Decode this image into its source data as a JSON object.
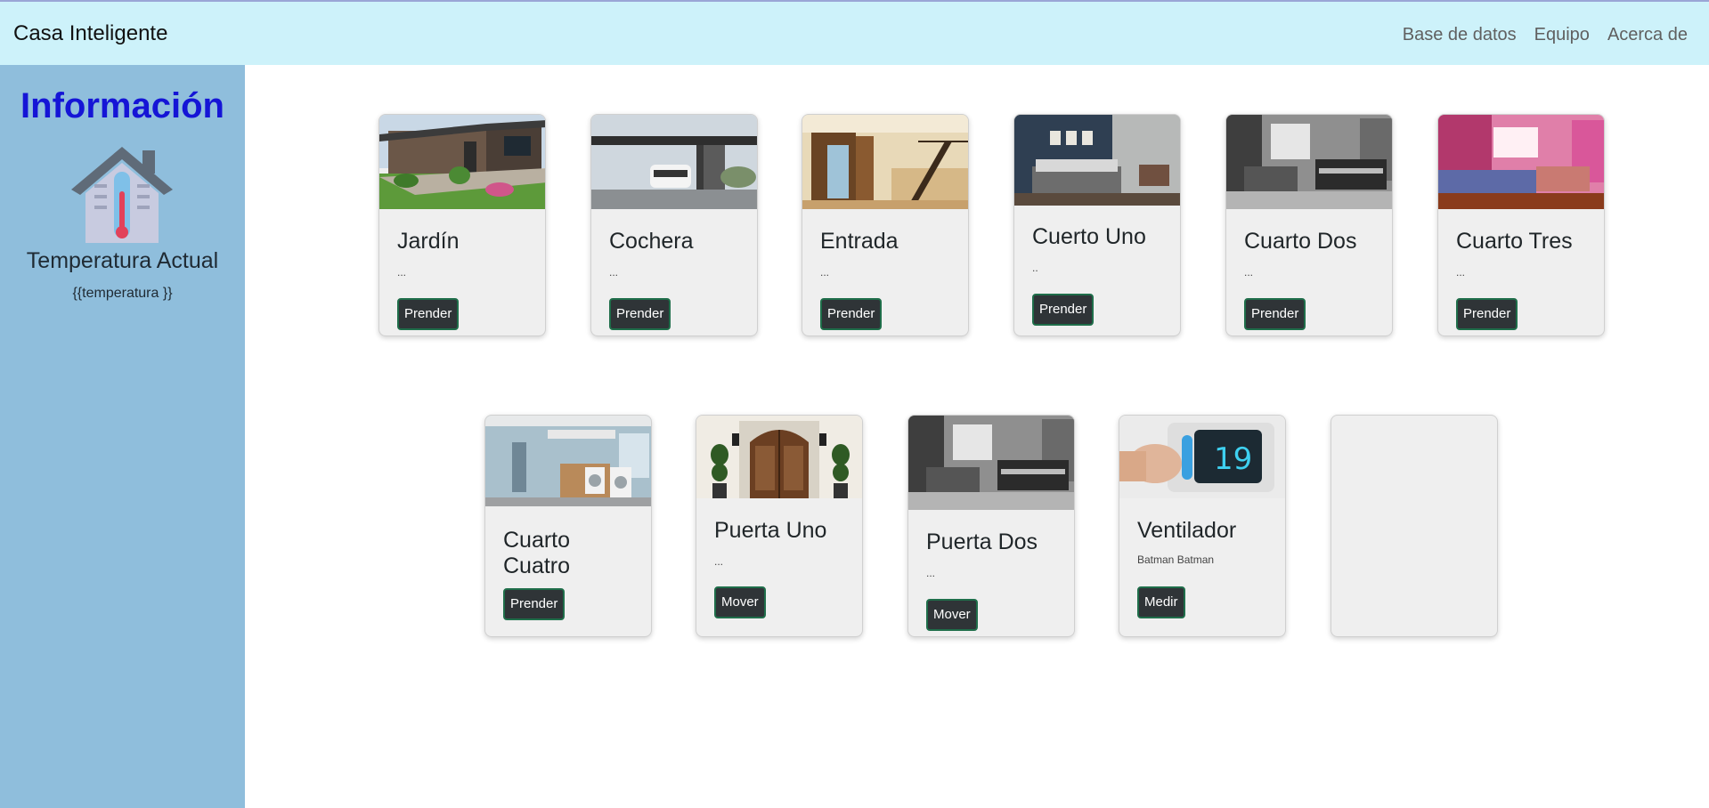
{
  "navbar": {
    "brand": "Casa Inteligente",
    "links": [
      "Base de datos",
      "Equipo",
      "Acerca de"
    ]
  },
  "sidebar": {
    "title": "Información",
    "icon": "thermometer-house-icon",
    "temp_label": "Temperatura Actual",
    "temp_value": "{{temperatura }}"
  },
  "cards": [
    {
      "title": "Jardín",
      "text": "...",
      "button": "Prender"
    },
    {
      "title": "Cochera",
      "text": "...",
      "button": "Prender"
    },
    {
      "title": "Entrada",
      "text": "...",
      "button": "Prender"
    },
    {
      "title": "Cuerto Uno",
      "text": "..",
      "button": "Prender"
    },
    {
      "title": "Cuarto Dos",
      "text": "...",
      "button": "Prender"
    },
    {
      "title": "Cuarto Tres",
      "text": "...",
      "button": "Prender"
    },
    {
      "title": "Cuarto Cuatro",
      "button": "Prender"
    },
    {
      "title": "Puerta Uno",
      "text": "...",
      "button": "Mover"
    },
    {
      "title": "Puerta Dos",
      "text": "...",
      "button": "Mover"
    },
    {
      "title": "Ventilador",
      "text": "Batman Batman",
      "button": "Medir"
    }
  ],
  "colors": {
    "navbar_bg": "#cdf2fa",
    "sidebar_bg": "#8fbedc",
    "sidebar_title": "#1515d6",
    "button_bg": "#2f3437",
    "card_bg": "#efefef"
  }
}
